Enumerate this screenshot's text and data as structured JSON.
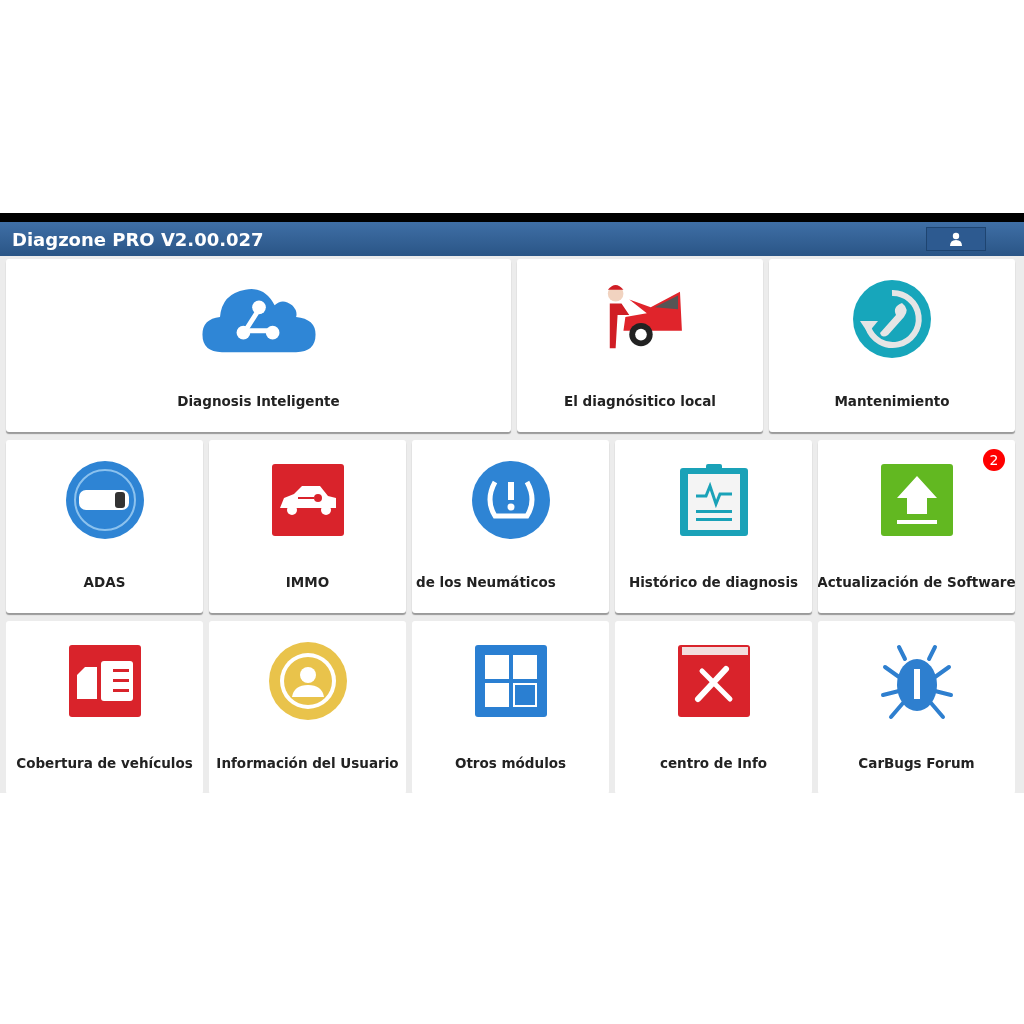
{
  "window": {
    "title": "Diagzone PRO V2.00.027"
  },
  "rows": [
    [
      {
        "label": "Diagnosis Inteligente",
        "kind": "cloud",
        "wide": true
      },
      {
        "label": "El diagnósitico local",
        "kind": "mechanic"
      },
      {
        "label": "Mantenimiento",
        "kind": "maintenance"
      }
    ],
    [
      {
        "label": "ADAS",
        "kind": "adas"
      },
      {
        "label": "IMMO",
        "kind": "immo"
      },
      {
        "label": "de los Neumáticos",
        "kind": "tpms",
        "clipped": true
      },
      {
        "label": "Histórico de diagnosis",
        "kind": "history"
      },
      {
        "label": "Actualización de Software",
        "kind": "update",
        "badge": "2"
      }
    ],
    [
      {
        "label": "Cobertura de vehículos",
        "kind": "coverage"
      },
      {
        "label": "Información del Usuario",
        "kind": "user"
      },
      {
        "label": "Otros módulos",
        "kind": "modules"
      },
      {
        "label": "centro de Info",
        "kind": "info"
      },
      {
        "label": "CarBugs Forum",
        "kind": "bug"
      }
    ]
  ]
}
